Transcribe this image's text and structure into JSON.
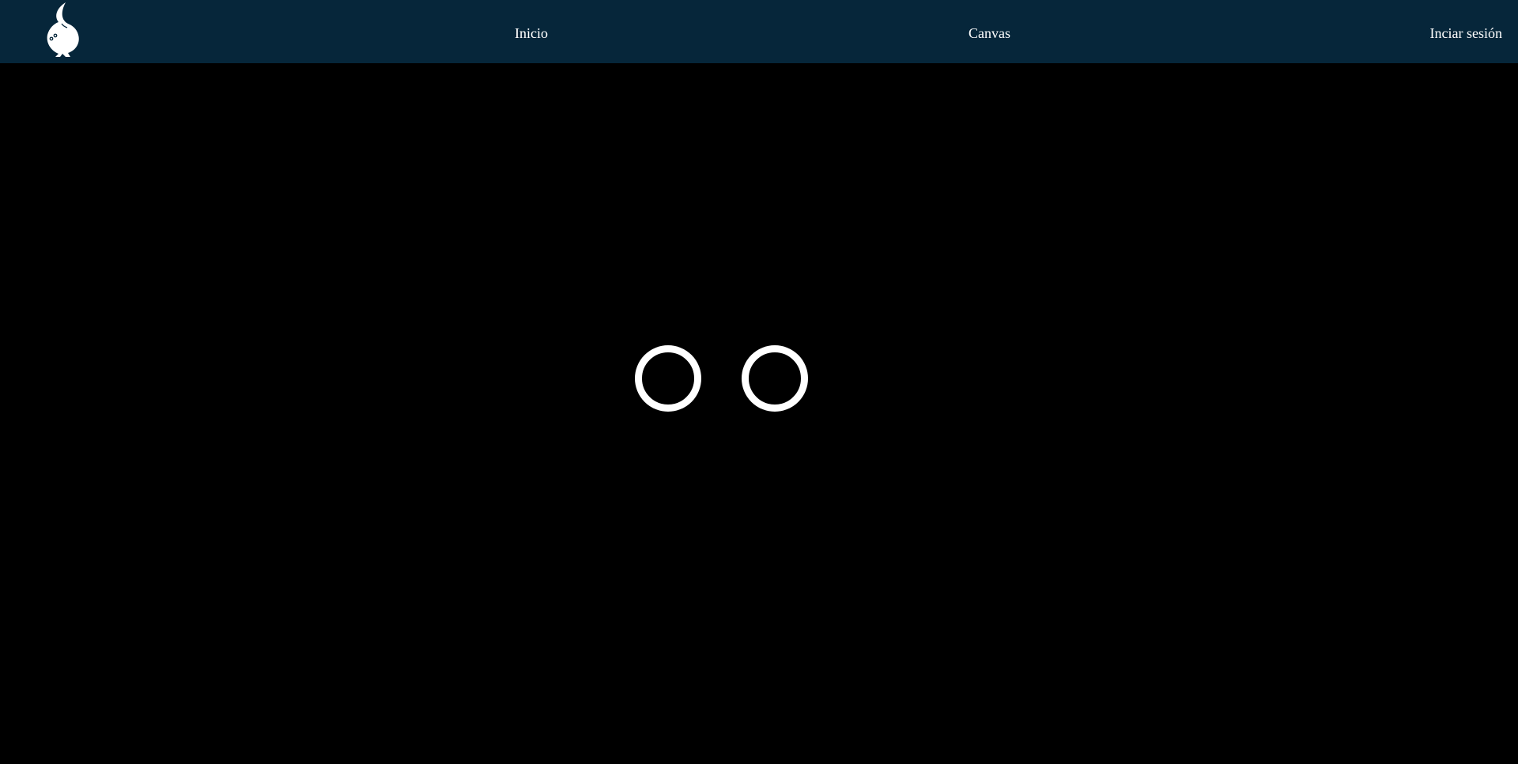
{
  "header": {
    "logo_icon": "flame-creature-logo-icon",
    "background_color": "#06263a",
    "nav": {
      "home_label": "Inicio",
      "canvas_label": "Canvas",
      "login_label": "Inciar sesión"
    }
  },
  "main": {
    "background_color": "#000000",
    "loader": {
      "icon": "loading-rings",
      "ring_color": "#ffffff",
      "ring_count": 2
    }
  }
}
